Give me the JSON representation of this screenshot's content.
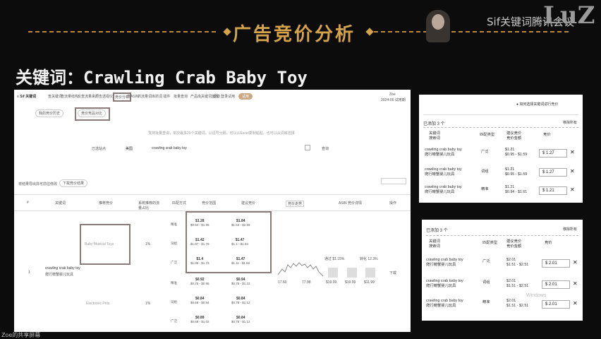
{
  "slide": {
    "title": "广告竞价分析",
    "brand": "Sif关键词",
    "brand_tail": "腾讯会议",
    "logo": "LuZ",
    "keyword_title": "关键词：Crawling Crab Baby Toy",
    "watermark": "Zoe的共享屏幕"
  },
  "main": {
    "logo": "≡ Sif 关键词",
    "nav_items": [
      "查关键词",
      "查流量结构",
      "反查流量来源",
      "广告透视仪",
      "竞价分析",
      "查ASIN",
      "抓流量词库",
      "抓词 插件",
      "批量查询",
      "产品库",
      "关键词监控",
      "帮助",
      "登录",
      "试用"
    ],
    "user": "Zoe",
    "date": "2024-06 试用期",
    "tabs": [
      "我的竞价历史",
      "竞价竞品对比"
    ],
    "notice": "支持批量查询，单次最多20个关键词，以逗号分隔，可以从Excel复制粘贴，也可以从词库选择",
    "search": {
      "site": "已选站点",
      "site_value": "美国",
      "keyword": "crawling crab baby toy",
      "button": "查询"
    },
    "export_hint": "将结果导出并可前往修改",
    "export_button": "下载竞价结果",
    "headers": [
      "#",
      "关键词",
      "推荐竞价",
      "系统推荐的流量占比",
      "匹配方式",
      "竞价范围",
      "建议竞价",
      "竞价走势",
      "ASIN 竞价详情",
      "操作"
    ],
    "row_index": "1",
    "row_keyword": "crawling crab baby toy",
    "row_keyword_cn": "爬行螃蟹婴儿玩具",
    "box1_label": "Baby Musical Toys",
    "box1_pct": "1%",
    "box2_label": "Electronic Pets",
    "box2_pct": "1%",
    "group1": [
      {
        "match": "精准",
        "bid": "$1.28",
        "range": "$0.94 - $1.95",
        "sugg": "$1.84",
        "sugg_range": "$1.53 - $2.55"
      },
      {
        "match": "词组",
        "bid": "$1.42",
        "range": "$1.07 - $1.79",
        "sugg": "$1.47",
        "sugg_range": "$1.1 - $1.84"
      },
      {
        "match": "广泛",
        "bid": "$1.4",
        "range": "$1.08 - $1.73",
        "sugg": "$1.47",
        "sugg_range": "$1.11 - $1.82"
      }
    ],
    "group2": [
      {
        "match": "精准",
        "bid": "$0.92",
        "range": "$0.75 - $0.95",
        "sugg": "$0.94",
        "sugg_range": "$0.78 - $1.23"
      },
      {
        "match": "词组",
        "bid": "$0.84",
        "range": "$0.68 - $0.94",
        "sugg": "$0.84",
        "sugg_range": "$0.78 - $1.12"
      },
      {
        "match": "广泛",
        "bid": "$0.89",
        "range": "$0.68 - $1.02",
        "sugg": "$0.84",
        "sugg_range": "$0.78 - $1.12"
      }
    ],
    "trend_min": "17.60",
    "trend_max": "77.98",
    "asin_label_1": "通过 $1.15%",
    "asin_label_2": "转化 12.3%",
    "asin_prices": [
      "$19.99",
      "$19.99",
      "$11.99"
    ],
    "action": "下载"
  },
  "panel1": {
    "header": "已添加 3 个",
    "clear": "移除所有",
    "hint": "如何选择关键词进行竞价",
    "cols": [
      "关键词",
      "匹配类型",
      "建议竞价",
      "竞价"
    ],
    "sub": "搜索词",
    "sub2": "竞价金额",
    "rows": [
      {
        "kw": "crawling crab baby toy",
        "cn": "爬行螃蟹婴儿玩具",
        "match": "广泛",
        "sugg": "$1.21",
        "range": "$0.95 - $1.59",
        "bid": "1.27"
      },
      {
        "kw": "crawling crab baby toy",
        "cn": "爬行螃蟹婴儿玩具",
        "match": "词组",
        "sugg": "$1.21",
        "range": "$0.95 - $1.59",
        "bid": "1.27"
      },
      {
        "kw": "crawling crab baby toy",
        "cn": "爬行螃蟹婴儿玩具",
        "match": "精准",
        "sugg": "$1.21",
        "range": "$0.94 - $1.61",
        "bid": "1.21"
      }
    ],
    "currency": "$"
  },
  "panel2": {
    "header": "已添加 3 个",
    "clear": "移除所有",
    "cols": [
      "关键词",
      "匹配类型",
      "建议竞价",
      "竞价"
    ],
    "sub": "搜索词",
    "sub2": "竞价金额",
    "rows": [
      {
        "kw": "crawling crab baby toy",
        "cn": "爬行螃蟹婴儿玩具",
        "match": "广泛",
        "sugg": "$2.01",
        "range": "$1.51 - $2.51",
        "bid": "2.01"
      },
      {
        "kw": "crawling crab baby toy",
        "cn": "爬行螃蟹婴儿玩具",
        "match": "词组",
        "sugg": "$2.01",
        "range": "$1.51 - $2.51",
        "bid": "2.01"
      },
      {
        "kw": "crawling crab baby toy",
        "cn": "爬行螃蟹婴儿玩具",
        "match": "精准",
        "sugg": "$2.01",
        "range": "$1.51 - $2.51",
        "bid": "2.01"
      }
    ],
    "currency": "$",
    "windows_wm": "Windows"
  }
}
